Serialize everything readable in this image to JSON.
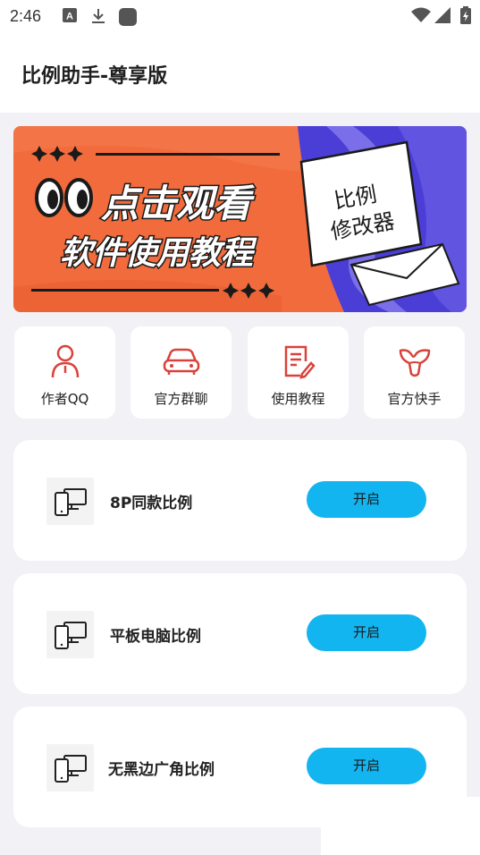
{
  "status_bar": {
    "time": "2:46"
  },
  "app": {
    "title": "比例助手-尊享版"
  },
  "banner": {
    "line1": "点击观看",
    "line2": "软件使用教程",
    "note_line1": "比例",
    "note_line2": "修改器",
    "colors": {
      "left": "#f26b3c",
      "right": "#4b3ed6"
    }
  },
  "shortcuts": [
    {
      "label": "作者QQ",
      "icon": "person-icon"
    },
    {
      "label": "官方群聊",
      "icon": "car-icon"
    },
    {
      "label": "使用教程",
      "icon": "document-edit-icon"
    },
    {
      "label": "官方快手",
      "icon": "kuaishou-icon"
    }
  ],
  "features": [
    {
      "title": "8P同款比例",
      "button": "开启",
      "icon": "phone-monitor-icon"
    },
    {
      "title": "平板电脑比例",
      "button": "开启",
      "icon": "phone-monitor-icon"
    },
    {
      "title": "无黑边广角比例",
      "button": "开启",
      "icon": "phone-monitor-icon"
    }
  ],
  "colors": {
    "accent": "#13b5f0",
    "icon_red": "#d9423b",
    "background": "#f2f1f6"
  }
}
